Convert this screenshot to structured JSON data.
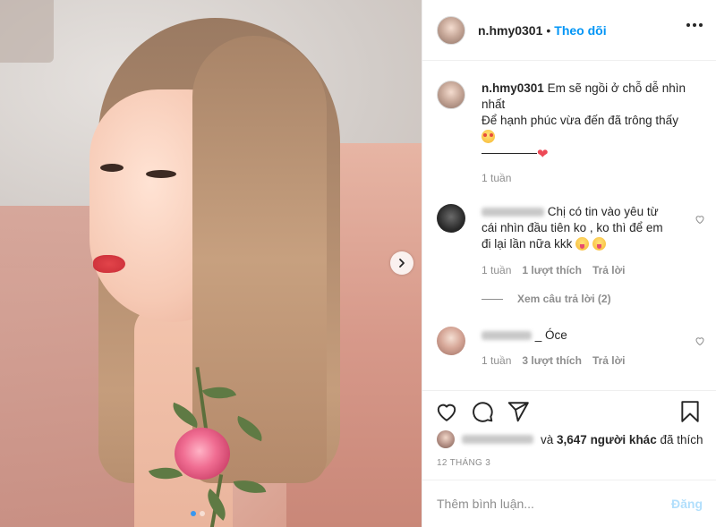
{
  "post": {
    "username": "n.hmy0301",
    "separator": "•",
    "follow_label": "Theo dõi",
    "more_icon": "more-horizontal-icon"
  },
  "caption": {
    "username": "n.hmy0301",
    "line1": "Em sẽ ngồi ở chỗ dễ nhìn nhất",
    "line2": "Để hạnh phúc vừa đến đã trông thấy",
    "heart": "❤",
    "time": "1 tuần"
  },
  "comments": [
    {
      "text": "Chị có tin vào yêu từ cái nhìn đầu tiên ko , ko thì để em đi lại lần nữa kkk",
      "time": "1 tuần",
      "likes": "1 lượt thích",
      "reply": "Trả lời",
      "view_replies": "Xem câu trả lời (2)"
    },
    {
      "text": "_ Óce",
      "time": "1 tuần",
      "likes": "3 lượt thích",
      "reply": "Trả lời"
    }
  ],
  "likes_summary": {
    "text_prefix": "và",
    "count": "3,647 người khác",
    "text_suffix": "đã thích"
  },
  "date": "12 THÁNG 3",
  "add_comment": {
    "placeholder": "Thêm bình luận...",
    "post_label": "Đăng"
  },
  "colors": {
    "accent": "#0095f6",
    "muted": "#8e8e8e",
    "heart": "#ed4956",
    "carousel_dot_active": "#3897f0"
  }
}
